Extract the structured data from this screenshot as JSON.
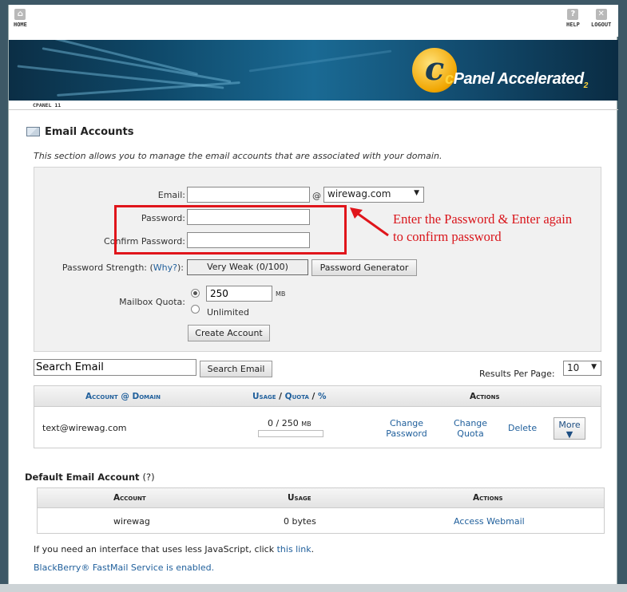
{
  "nav": {
    "home": "HOME",
    "help": "HELP",
    "logout": "LOGOUT"
  },
  "banner": {
    "brand_c": "c",
    "brand_panel": "Panel",
    "brand_accel": " Accelerated",
    "brand_sub": "2"
  },
  "subbar": {
    "tag": "CPANEL 11"
  },
  "page": {
    "title": "Email Accounts",
    "description": "This section allows you to manage the email accounts that are associated with your domain."
  },
  "form": {
    "email_label": "Email:",
    "email_value": "",
    "at": "@",
    "domain_value": "wirewag.com",
    "password_label": "Password:",
    "confirm_label": "Confirm Password:",
    "strength_label": "Password Strength:",
    "strength_why_open": "(",
    "strength_why": "Why?",
    "strength_why_close": "):",
    "strength_value": "Very Weak (0/100)",
    "generator_button": "Password Generator",
    "quota_label": "Mailbox Quota:",
    "quota_value": "250",
    "quota_unit": "MB",
    "unlimited_label": "Unlimited",
    "create_button": "Create Account"
  },
  "annotation": {
    "line1": "Enter the Password & Enter again",
    "line2": "to confirm password",
    "color": "#e0151b"
  },
  "search": {
    "placeholder": "Search Email",
    "button": "Search Email",
    "results_label": "Results Per Page:",
    "results_value": "10"
  },
  "accounts_table": {
    "col_account": "Account @ Domain",
    "col_usage": "Usage",
    "col_sep1": " / ",
    "col_quota": "Quota",
    "col_sep2": " / ",
    "col_percent": "%",
    "col_actions": "Actions",
    "rows": [
      {
        "account": "text@wirewag.com",
        "usage": "0 / 250",
        "usage_unit": "MB",
        "usage_fraction": 0,
        "change_password_1": "Change",
        "change_password_2": "Password",
        "change_quota_1": "Change",
        "change_quota_2": "Quota",
        "delete": "Delete",
        "more": "More",
        "more_arrow": "▼"
      }
    ]
  },
  "default_account": {
    "title": "Default Email Account",
    "help": "(?)",
    "col_account": "Account",
    "col_usage": "Usage",
    "col_actions": "Actions",
    "row": {
      "account": "wirewag",
      "usage": "0 bytes",
      "action": "Access Webmail"
    }
  },
  "footer": {
    "lite_prefix": "If you need an interface that uses less JavaScript, click ",
    "lite_link": "this link",
    "lite_suffix": ".",
    "blackberry": "BlackBerry® FastMail Service is enabled."
  },
  "colors": {
    "link": "#21609c",
    "annotation_red": "#e0151b",
    "banner_blue": "#124b6e"
  }
}
